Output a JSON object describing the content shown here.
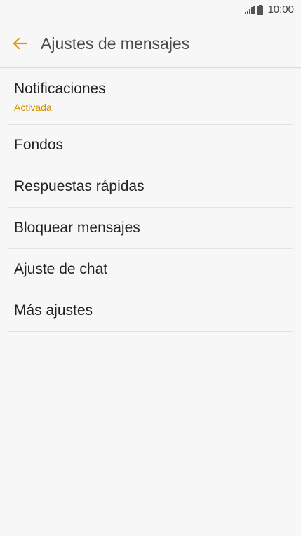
{
  "status_bar": {
    "time": "10:00",
    "signal_icon": "signal-icon",
    "battery_icon": "battery-icon"
  },
  "app_bar": {
    "back_icon": "arrow-left-icon",
    "title": "Ajustes de mensajes",
    "accent_color": "#e8960f"
  },
  "settings": {
    "items": [
      {
        "title": "Notificaciones",
        "subtitle": "Activada"
      },
      {
        "title": "Fondos"
      },
      {
        "title": "Respuestas rápidas"
      },
      {
        "title": "Bloquear mensajes"
      },
      {
        "title": "Ajuste de chat"
      },
      {
        "title": "Más ajustes"
      }
    ],
    "subtitle_color": "#d39000"
  }
}
